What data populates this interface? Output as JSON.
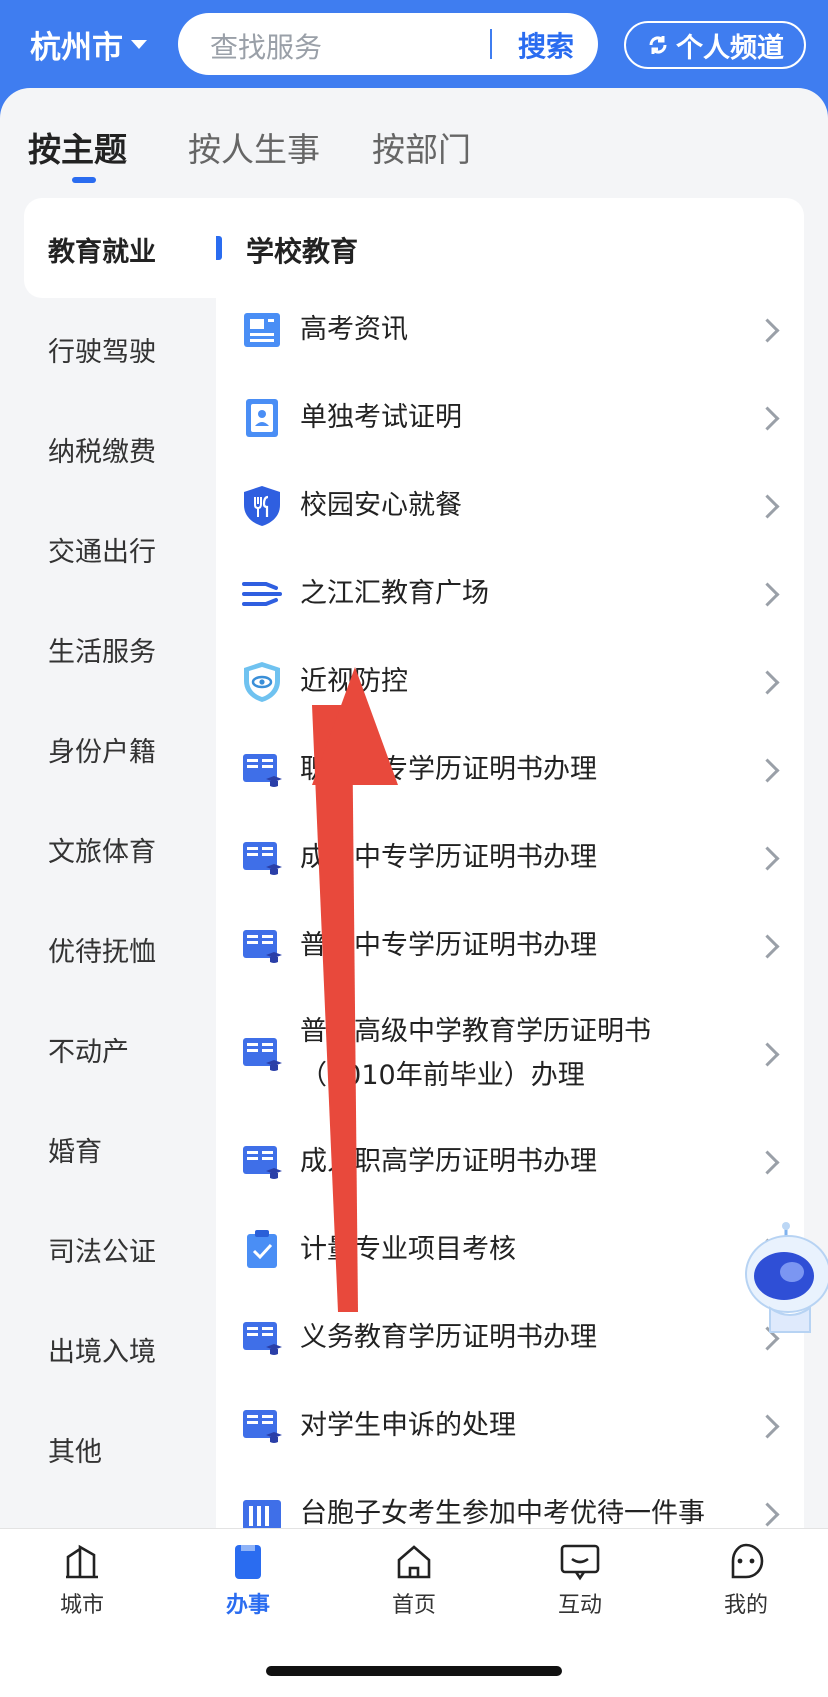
{
  "header": {
    "city": "杭州市",
    "search_placeholder": "查找服务",
    "search_button": "搜索",
    "channel_button": "个人频道"
  },
  "tabs": [
    "按主题",
    "按人生事",
    "按部门"
  ],
  "sidebar": [
    "教育就业",
    "行驶驾驶",
    "纳税缴费",
    "交通出行",
    "生活服务",
    "身份户籍",
    "文旅体育",
    "优待抚恤",
    "不动产",
    "婚育",
    "司法公证",
    "出境入境",
    "其他"
  ],
  "section_title": "学校教育",
  "services": [
    {
      "label": "高考资讯",
      "icon": "newspaper-icon"
    },
    {
      "label": "单独考试证明",
      "icon": "id-card-icon"
    },
    {
      "label": "校园安心就餐",
      "icon": "shield-cutlery-icon"
    },
    {
      "label": "之江汇教育广场",
      "icon": "wave-lines-icon"
    },
    {
      "label": "近视防控",
      "icon": "shield-eye-icon"
    },
    {
      "label": "职业中专学历证明书办理",
      "icon": "book-grad-icon"
    },
    {
      "label": "成人中专学历证明书办理",
      "icon": "book-grad-icon"
    },
    {
      "label": "普通中专学历证明书办理",
      "icon": "book-grad-icon"
    },
    {
      "label": "普通高级中学教育学历证明书（2010年前毕业）办理",
      "icon": "book-grad-icon"
    },
    {
      "label": "成人职高学历证明书办理",
      "icon": "book-grad-icon"
    },
    {
      "label": "计量专业项目考核",
      "icon": "clipboard-check-icon"
    },
    {
      "label": "义务教育学历证明书办理",
      "icon": "book-grad-icon"
    },
    {
      "label": "对学生申诉的处理",
      "icon": "book-grad-icon"
    },
    {
      "label": "台胞子女考生参加中考优待一件事",
      "icon": "book-icon"
    }
  ],
  "nav": [
    {
      "label": "城市",
      "icon": "city-icon"
    },
    {
      "label": "办事",
      "icon": "service-icon"
    },
    {
      "label": "首页",
      "icon": "home-icon"
    },
    {
      "label": "互动",
      "icon": "chat-icon"
    },
    {
      "label": "我的",
      "icon": "profile-icon"
    }
  ],
  "colors": {
    "accent": "#2a6cf0",
    "header": "#3f7df0",
    "arrow": "#e8493c"
  }
}
